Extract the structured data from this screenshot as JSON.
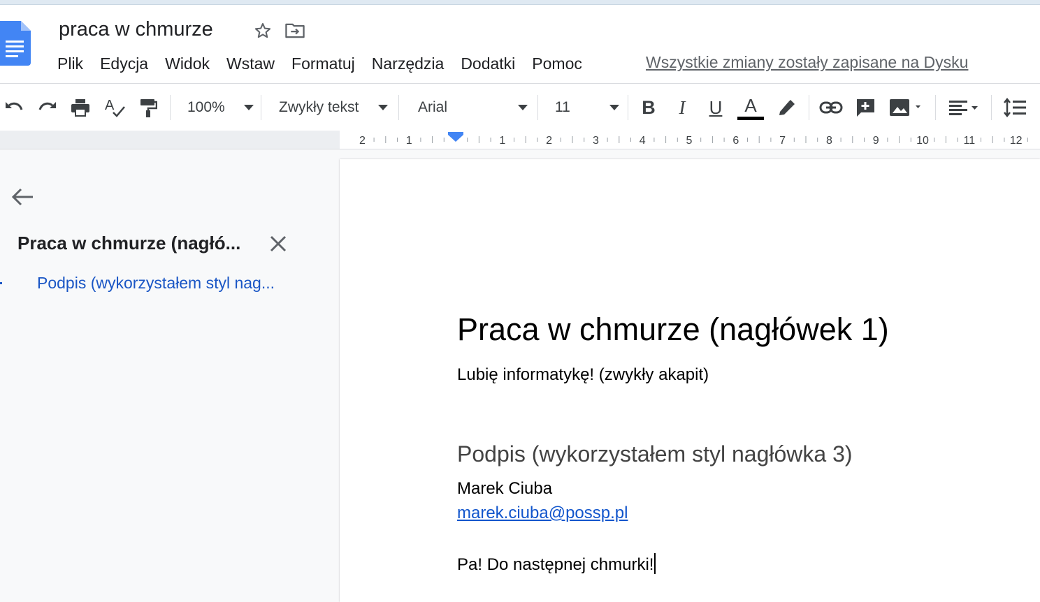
{
  "header": {
    "title": "praca w chmurze",
    "save_status": "Wszystkie zmiany zostały zapisane na Dysku",
    "icons": [
      "docs-logo-icon",
      "star-icon",
      "move-to-folder-icon"
    ]
  },
  "menu": {
    "items": [
      "Plik",
      "Edycja",
      "Widok",
      "Wstaw",
      "Formatuj",
      "Narzędzia",
      "Dodatki",
      "Pomoc"
    ]
  },
  "toolbar": {
    "zoom": "100%",
    "style": "Zwykły tekst",
    "font": "Arial",
    "size": "11",
    "bold": "B",
    "italic": "I",
    "underline": "U",
    "text_color": "A",
    "icons": [
      "undo-icon",
      "redo-icon",
      "print-icon",
      "spellcheck-icon",
      "paint-format-icon",
      "highlight-icon",
      "link-icon",
      "add-comment-icon",
      "insert-image-icon",
      "align-left-icon",
      "line-spacing-icon"
    ]
  },
  "ruler": {
    "marks": [
      "2",
      "1",
      "1",
      "2",
      "3",
      "4",
      "5",
      "6",
      "7",
      "8",
      "9",
      "10",
      "11",
      "12"
    ]
  },
  "outline": {
    "title": "Praca w chmurze (nagłó...",
    "items": [
      "Podpis (wykorzystałem styl nag..."
    ]
  },
  "document": {
    "heading1": "Praca w chmurze (nagłówek 1)",
    "paragraph1": "Lubię informatykę! (zwykły akapit)",
    "heading3": "Podpis (wykorzystałem styl nagłówka 3)",
    "name": "Marek Ciuba",
    "email": "marek.ciuba@possp.pl",
    "closing": "Pa! Do następnej chmurki!"
  },
  "colors": {
    "accent": "#4285f4",
    "link": "#1155cc",
    "outline_link": "#1a56c5",
    "sidebar_bg": "#f8f9fa",
    "text_color_bar": "#000000"
  }
}
